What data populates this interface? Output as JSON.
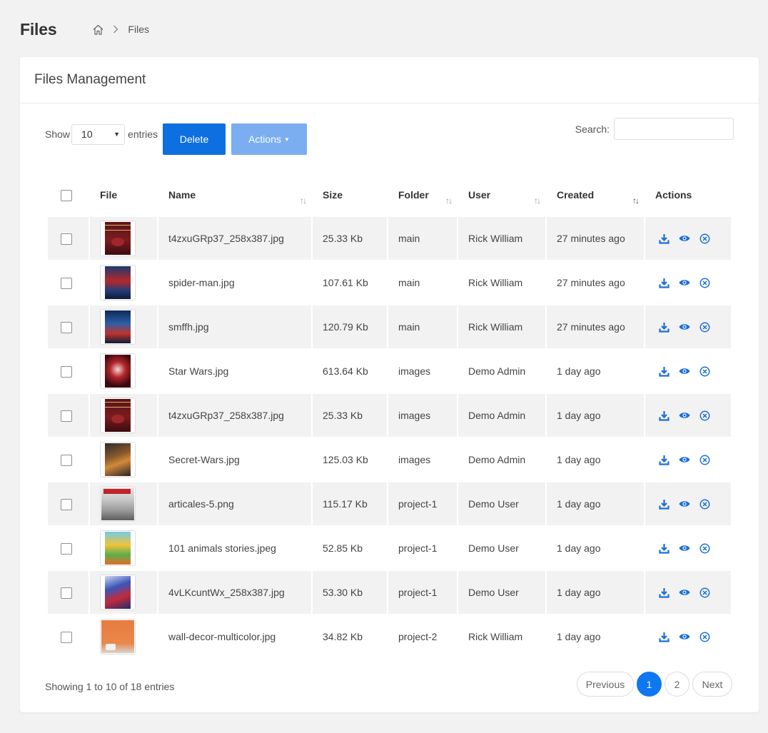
{
  "page": {
    "title": "Files"
  },
  "breadcrumb": {
    "current": "Files"
  },
  "card": {
    "title": "Files Management"
  },
  "controls": {
    "show_label": "Show",
    "entries_value": "10",
    "entries_label": "entries",
    "delete_label": "Delete",
    "actions_label": "Actions",
    "search_label": "Search:",
    "search_value": ""
  },
  "table": {
    "headers": {
      "file": "File",
      "name": "Name",
      "size": "Size",
      "folder": "Folder",
      "user": "User",
      "created": "Created",
      "actions": "Actions"
    },
    "rows": [
      {
        "name": "t4zxuGRp37_258x387.jpg",
        "size": "25.33 Kb",
        "folder": "main",
        "user": "Rick William",
        "created": "27 minutes ago",
        "thumb": "harry-potter-cover"
      },
      {
        "name": "spider-man.jpg",
        "size": "107.61 Kb",
        "folder": "main",
        "user": "Rick William",
        "created": "27 minutes ago",
        "thumb": "spider-man-poster"
      },
      {
        "name": "smffh.jpg",
        "size": "120.79 Kb",
        "folder": "main",
        "user": "Rick William",
        "created": "27 minutes ago",
        "thumb": "spider-man-far-from-home-poster"
      },
      {
        "name": "Star Wars.jpg",
        "size": "613.64 Kb",
        "folder": "images",
        "user": "Demo Admin",
        "created": "1 day ago",
        "thumb": "star-wars-cover"
      },
      {
        "name": "t4zxuGRp37_258x387.jpg",
        "size": "25.33 Kb",
        "folder": "images",
        "user": "Demo Admin",
        "created": "1 day ago",
        "thumb": "harry-potter-cover"
      },
      {
        "name": "Secret-Wars.jpg",
        "size": "125.03 Kb",
        "folder": "images",
        "user": "Demo Admin",
        "created": "1 day ago",
        "thumb": "secret-wars-cover"
      },
      {
        "name": "articales-5.png",
        "size": "115.17 Kb",
        "folder": "project-1",
        "user": "Demo User",
        "created": "1 day ago",
        "thumb": "article-5-cover"
      },
      {
        "name": "101 animals stories.jpeg",
        "size": "52.85 Kb",
        "folder": "project-1",
        "user": "Demo User",
        "created": "1 day ago",
        "thumb": "animals-stories-cover"
      },
      {
        "name": "4vLKcuntWx_258x387.jpg",
        "size": "53.30 Kb",
        "folder": "project-1",
        "user": "Demo User",
        "created": "1 day ago",
        "thumb": "spider-man-comic-cover"
      },
      {
        "name": "wall-decor-multicolor.jpg",
        "size": "34.82 Kb",
        "folder": "project-2",
        "user": "Rick William",
        "created": "1 day ago",
        "thumb": "wall-decor-photo"
      }
    ]
  },
  "footer": {
    "info": "Showing 1 to 10 of 18 entries",
    "previous": "Previous",
    "pages": [
      "1",
      "2"
    ],
    "next": "Next"
  },
  "colors": {
    "primary": "#0d6fe0",
    "primary_light": "#7aaef0",
    "icon_blue": "#1b6fd6",
    "stripe": "#f2f2f2"
  }
}
